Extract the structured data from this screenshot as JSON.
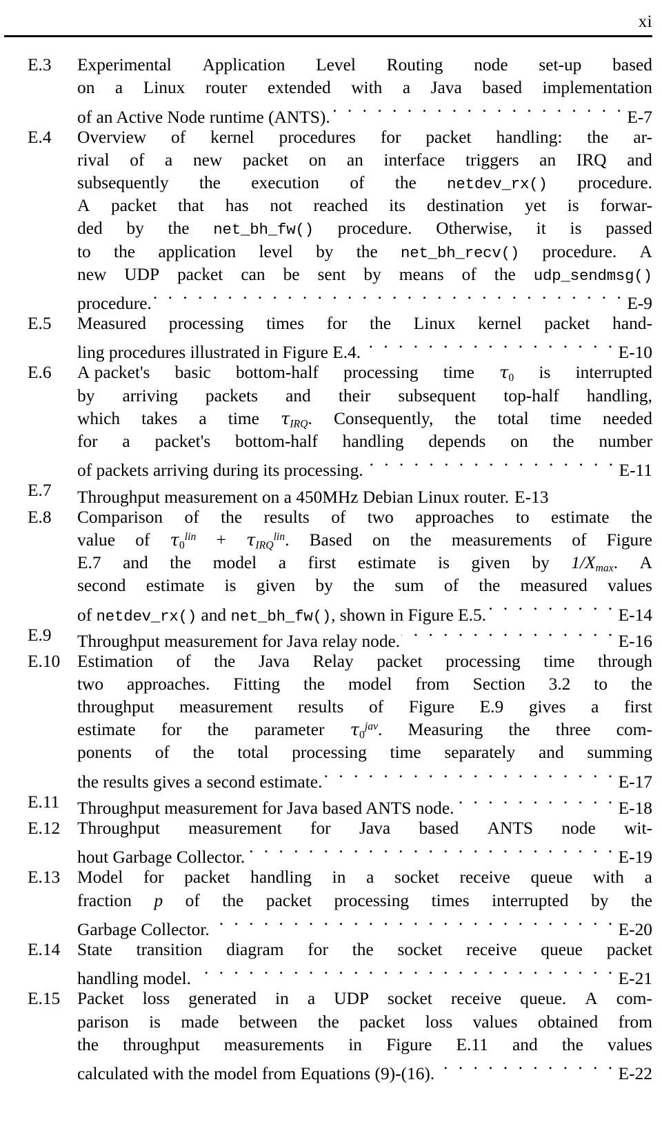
{
  "header": {
    "folio": "xi"
  },
  "list_of_figures": {
    "entries": [
      {
        "label": "E.3",
        "page": "E-7",
        "lines": [
          "Experimental Application Level Routing node set-up based",
          "on a Linux router extended with a Java based implementation",
          "of an Active Node runtime (ANTS)."
        ]
      },
      {
        "label": "E.4",
        "page": "E-9",
        "lines": [
          "Overview of kernel procedures for packet handling: the ar-",
          "rival of a new packet on an interface triggers an IRQ and",
          "subsequently the execution of the netdev_rx() procedure.",
          "A packet that has not reached its destination yet is forwar-",
          "ded by the net_bh_fw() procedure. Otherwise, it is passed",
          "to the application level by the net_bh_recv() procedure. A",
          "new UDP packet can be sent by means of the udp_sendmsg()",
          "procedure."
        ]
      },
      {
        "label": "E.5",
        "page": "E-10",
        "lines": [
          "Measured processing times for the Linux kernel packet hand-",
          "ling procedures illustrated in Figure E.4."
        ]
      },
      {
        "label": "E.6",
        "page": "E-11",
        "lines": [
          "A packet's basic bottom-half processing time τ0 is interrupted",
          "by arriving packets and their subsequent top-half handling,",
          "which takes a time τIRQ. Consequently, the total time needed",
          "for a packet's bottom-half handling depends on the number",
          "of packets arriving during its processing."
        ]
      },
      {
        "label": "E.7",
        "page": "E-13",
        "lines": [
          "Throughput measurement on a 450MHz Debian Linux router."
        ]
      },
      {
        "label": "E.8",
        "page": "E-14",
        "lines": [
          "Comparison of the results of two approaches to estimate the",
          "value of τ0lin + τIRQlin. Based on the measurements of Figure",
          "E.7 and the model a first estimate is given by 1/Xmax. A",
          "second estimate is given by the sum of the measured values",
          "of netdev_rx() and net_bh_fw(), shown in Figure E.5."
        ]
      },
      {
        "label": "E.9",
        "page": "E-16",
        "lines": [
          "Throughput measurement for Java relay node."
        ]
      },
      {
        "label": "E.10",
        "page": "E-17",
        "lines": [
          "Estimation of the Java Relay packet processing time through",
          "two approaches. Fitting the model from Section 3.2 to the",
          "throughput measurement results of Figure E.9 gives a first",
          "estimate for the parameter τ0jav. Measuring the three com-",
          "ponents of the total processing time separately and summing",
          "the results gives a second estimate."
        ]
      },
      {
        "label": "E.11",
        "page": "E-18",
        "lines": [
          "Throughput measurement for Java based ANTS node."
        ]
      },
      {
        "label": "E.12",
        "page": "E-19",
        "lines": [
          "Throughput measurement for Java based ANTS node wit-",
          "hout Garbage Collector."
        ]
      },
      {
        "label": "E.13",
        "page": "E-20",
        "lines": [
          "Model for packet handling in a socket receive queue with a",
          "fraction p of the packet processing times interrupted by the",
          "Garbage Collector."
        ]
      },
      {
        "label": "E.14",
        "page": "E-21",
        "lines": [
          "State transition diagram for the socket receive queue packet",
          "handling model."
        ]
      },
      {
        "label": "E.15",
        "page": "E-22",
        "lines": [
          "Packet loss generated in a UDP socket receive queue. A com-",
          "parison is made between the packet loss values obtained from",
          "the throughput measurements in Figure E.11 and the values",
          "calculated with the model from Equations (9)-(16)."
        ]
      }
    ],
    "labels": {
      "e3": "E.3",
      "e4": "E.4",
      "e5": "E.5",
      "e6": "E.6",
      "e7": "E.7",
      "e8": "E.8",
      "e9": "E.9",
      "e10": "E.10",
      "e11": "E.11",
      "e12": "E.12",
      "e13": "E.13",
      "e14": "E.14",
      "e15": "E.15"
    },
    "pages": {
      "e3": "E-7",
      "e4": "E-9",
      "e5": "E-10",
      "e6": "E-11",
      "e7": "E-13",
      "e8": "E-14",
      "e9": "E-16",
      "e10": "E-17",
      "e11": "E-18",
      "e12": "E-19",
      "e13": "E-20",
      "e14": "E-21",
      "e15": "E-22"
    },
    "code_terms": {
      "netdev_rx": "netdev_rx()",
      "net_bh_fw": "net_bh_fw()",
      "net_bh_recv": "net_bh_recv()",
      "udp_sendmsg": "udp_sendmsg()"
    },
    "math": {
      "tau": "τ",
      "sub_zero": "0",
      "sub_irq": "IRQ",
      "sup_lin": "lin",
      "sup_jav": "jav",
      "plus": "+",
      "one_over_x": "1/X",
      "sub_max": "max",
      "frac_p": "p"
    }
  }
}
